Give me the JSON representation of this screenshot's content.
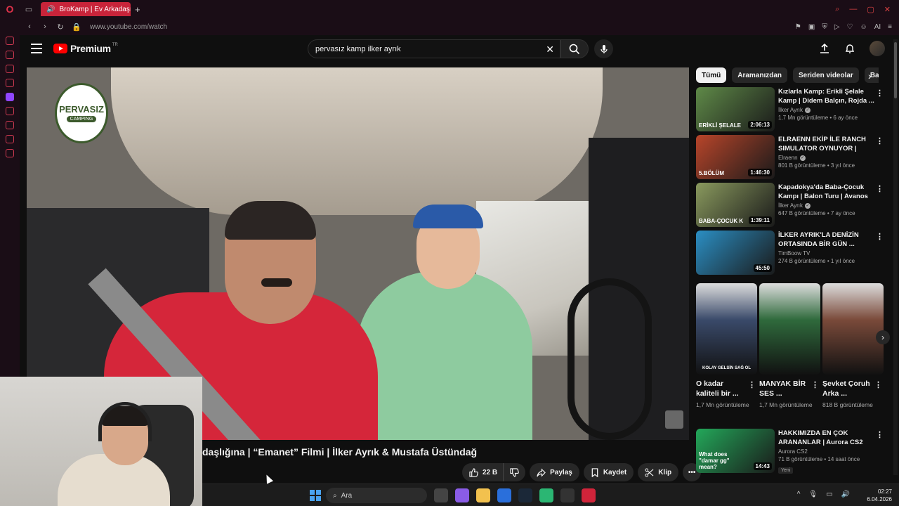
{
  "browser": {
    "tab_title": "BroKamp | Ev Arkadaşı",
    "url": "www.youtube.com/watch",
    "ai_label": "AI"
  },
  "youtube": {
    "logo_text": "Premium",
    "logo_region": "TR",
    "search_value": "pervasız kamp ilker ayrık"
  },
  "video": {
    "title": "daşlığına | “Emanet” Filmi | İlker Ayrık & Mustafa Üstündağ",
    "channel_logo_line1": "PERVASIZ",
    "channel_logo_line2": "CAMPING",
    "likes": "22 B",
    "share_label": "Paylaş",
    "save_label": "Kaydet",
    "clip_label": "Klip"
  },
  "chips": [
    "Tümü",
    "Aramanızdan",
    "Seriden videolar",
    "Bal"
  ],
  "recommendations": [
    {
      "title": "Kızlarla Kamp: Erikli Şelale Kamp | Didem Balçın, Rojda ...",
      "channel": "İlker Ayrık",
      "verified": true,
      "meta": "1,7 Mn görüntüleme • 6 ay önce",
      "duration": "2:06:13",
      "thumb_text": "ERİKLİ ŞELALE",
      "thumb_color": "#5f8a48"
    },
    {
      "title": "ELRAENN EKİP İLE RANCH SIMULATOR OYNUYOR | TEMİ...",
      "channel": "Elraenn",
      "verified": true,
      "meta": "801 B görüntüleme • 3 yıl önce",
      "duration": "1:46:30",
      "thumb_text": "5.BÖLÜM",
      "thumb_color": "#b8452a"
    },
    {
      "title": "Kapadokya'da Baba-Çocuk Kampı | Balon Turu | Avanos v...",
      "channel": "İlker Ayrık",
      "verified": true,
      "meta": "647 B görüntüleme • 7 ay önce",
      "duration": "1:39:11",
      "thumb_text": "BABA-ÇOCUK K",
      "thumb_color": "#8a9a5e"
    },
    {
      "title": "İLKER AYRIK'LA DENİZİN ORTASINDA BİR GÜN ...",
      "channel": "TimBoow TV",
      "verified": false,
      "meta": "274 B görüntüleme • 1 yıl önce",
      "duration": "45:50",
      "thumb_text": "",
      "thumb_color": "#2b8fc4"
    },
    {
      "title": "HAKKIMIZDA EN ÇOK ARANANLAR | Aurora CS2",
      "channel": "Aurora CS2",
      "verified": false,
      "meta": "71 B görüntüleme • 14 saat önce",
      "duration": "14:43",
      "badge": "Yeni",
      "thumb_text": "What does \"damar gg\" mean?",
      "thumb_color": "#23a85a"
    }
  ],
  "shorts": [
    {
      "title": "O kadar kaliteli bir ...",
      "views": "1,7 Mn görüntüleme",
      "thumb_text": "KOLAY GELSİN SAĞ OL",
      "thumb_color": "#3a4a6a"
    },
    {
      "title": "MANYAK BİR SES ...",
      "views": "1,7 Mn görüntüleme",
      "thumb_text": "",
      "thumb_color": "#2f6a3c"
    },
    {
      "title": "Şevket Çoruh Arka ...",
      "views": "818 B görüntüleme",
      "thumb_text": "",
      "thumb_color": "#7a4a3a"
    }
  ],
  "taskbar": {
    "search_placeholder": "Ara",
    "time": "02:27",
    "date": "6.04.2026"
  }
}
